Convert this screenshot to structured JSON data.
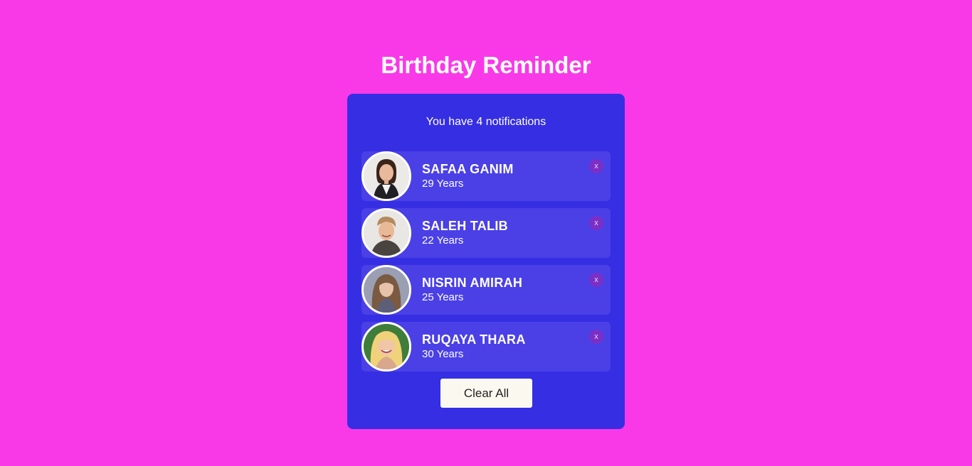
{
  "header": {
    "title": "Birthday Reminder"
  },
  "card": {
    "notification_text": "You have 4 notifications",
    "clear_label": "Clear All"
  },
  "people": [
    {
      "name": "SAFAA GANIM",
      "age": "29 Years",
      "remove_label": "x"
    },
    {
      "name": "SALEH TALIB",
      "age": "22 Years",
      "remove_label": "x"
    },
    {
      "name": "NISRIN AMIRAH",
      "age": "25 Years",
      "remove_label": "x"
    },
    {
      "name": "RUQAYA THARA",
      "age": "30 Years",
      "remove_label": "x"
    }
  ],
  "colors": {
    "background": "#f939e8",
    "card": "#352ee3",
    "row": "#4a40e6",
    "remove_button": "#7c2fc6",
    "clear_button": "#fbf9ef"
  }
}
